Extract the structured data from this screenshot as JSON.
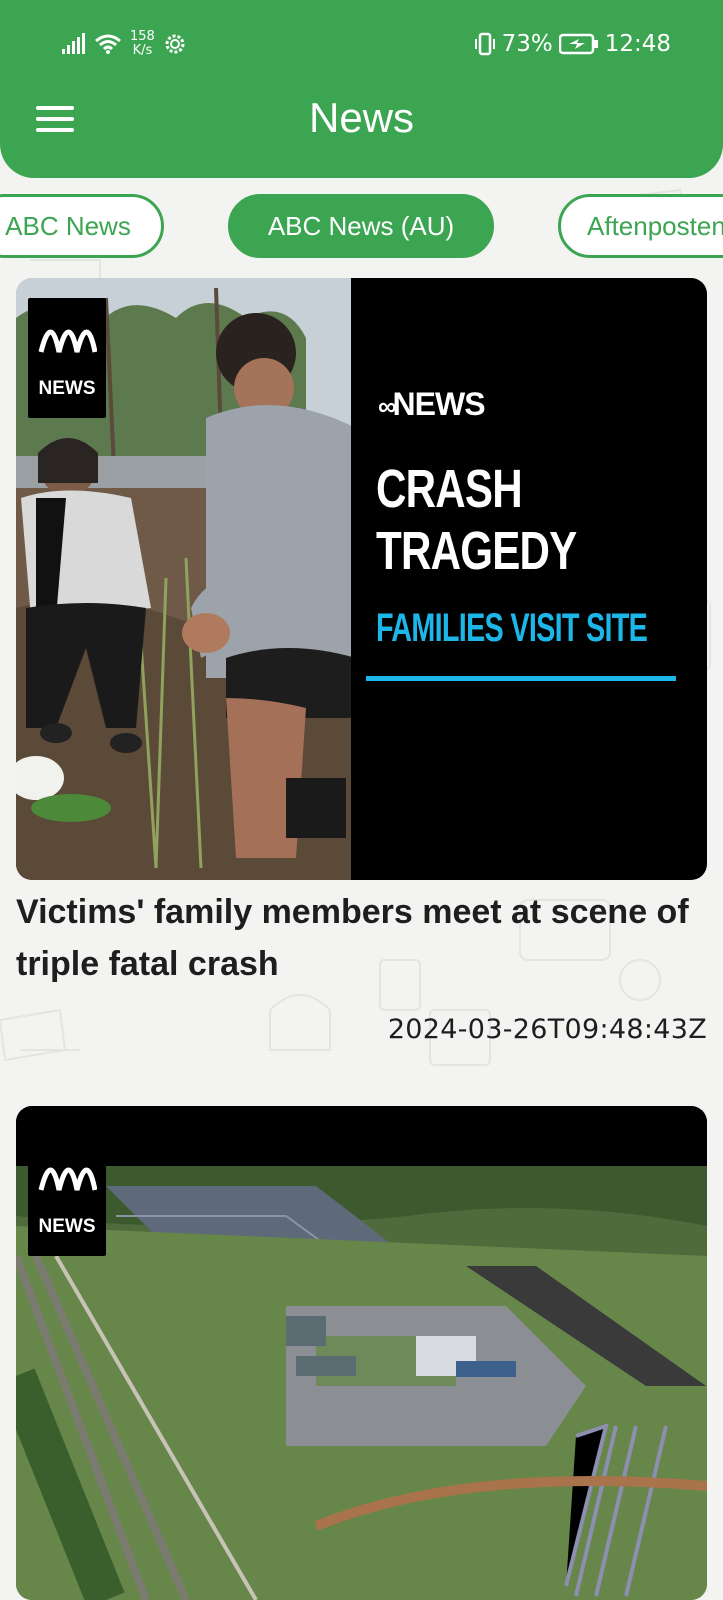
{
  "status_bar": {
    "net_speed_value": "158",
    "net_speed_unit": "K/s",
    "battery_percent": "73%",
    "time": "12:48"
  },
  "app_bar": {
    "title": "News",
    "menu_icon": "hamburger-menu-icon"
  },
  "sources": [
    {
      "label": "ABC News",
      "active": false
    },
    {
      "label": "ABC News (AU)",
      "active": true
    },
    {
      "label": "Aftenposten",
      "active": false
    }
  ],
  "articles": [
    {
      "image_logo_text": "NEWS",
      "image_overlay": {
        "brand": "NEWS",
        "line1": "CRASH",
        "line2": "TRAGEDY",
        "subline": "FAMILIES VISIT SITE"
      },
      "title": "Victims' family members meet at scene of triple fatal crash",
      "published": "2024-03-26T09:48:43Z"
    },
    {
      "image_logo_text": "NEWS",
      "title": "",
      "published": ""
    }
  ],
  "colors": {
    "brand_green": "#3ba552",
    "overlay_blue": "#1cb6e8",
    "overlay_black": "#000000"
  }
}
